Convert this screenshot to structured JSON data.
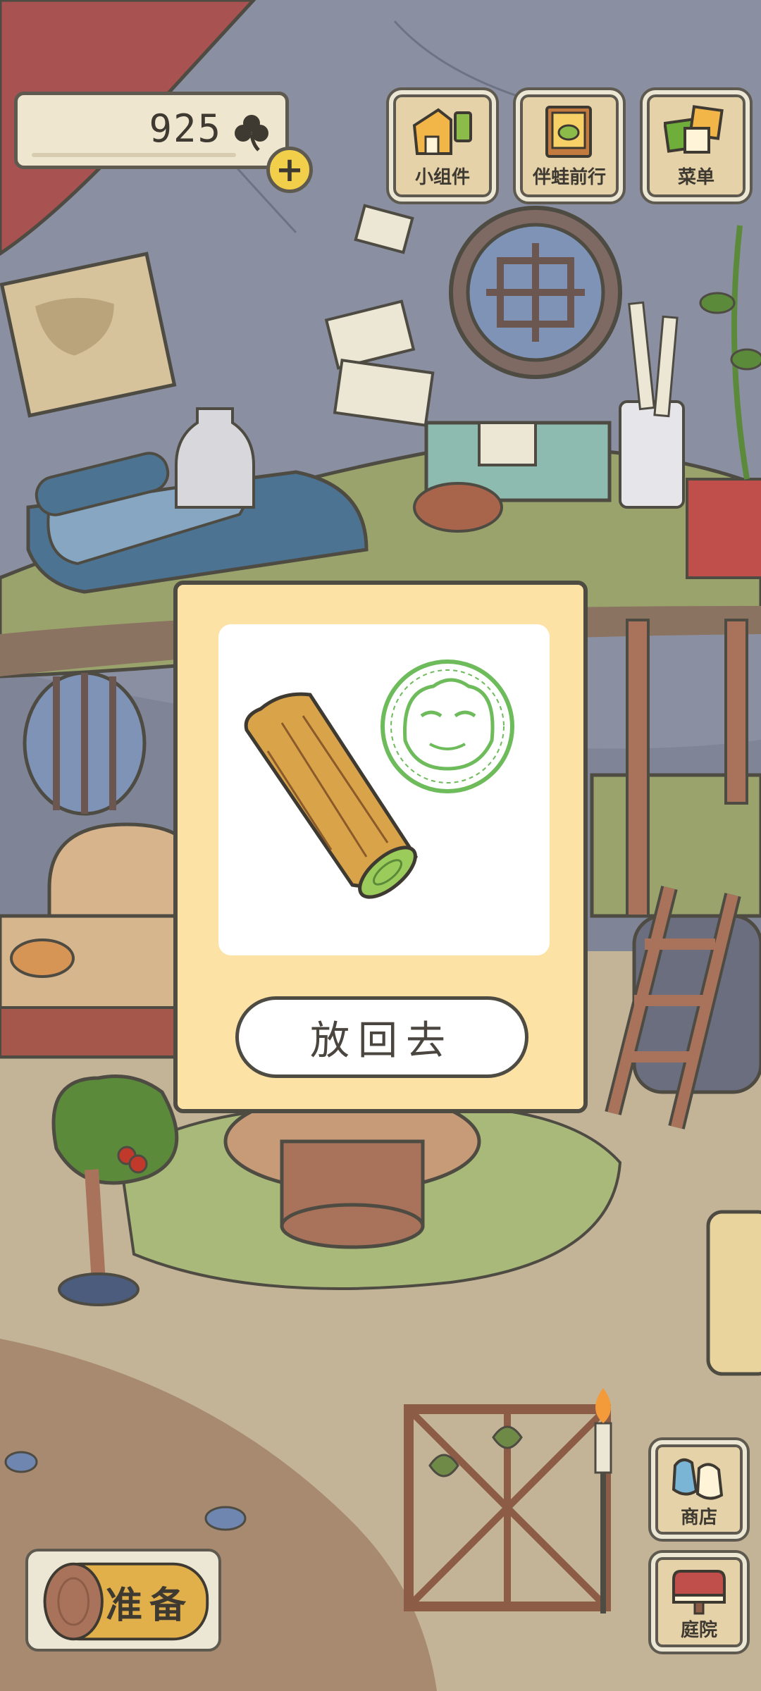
{
  "currency": {
    "amount": "925",
    "icon": "clover-icon",
    "add_icon": "plus-icon"
  },
  "top_buttons": [
    {
      "label": "小组件",
      "icon": "widget-icon"
    },
    {
      "label": "伴蛙前行",
      "icon": "frog-book-icon"
    },
    {
      "label": "菜单",
      "icon": "menu-cards-icon"
    }
  ],
  "side_buttons": [
    {
      "label": "商店",
      "icon": "shop-bags-icon"
    },
    {
      "label": "庭院",
      "icon": "yard-mailbox-icon"
    }
  ],
  "ready_button": {
    "label": "准备",
    "icon": "log-icon"
  },
  "item_dialog": {
    "item_icon": "log-item-icon",
    "stamp_icon": "frog-stamp-icon",
    "action_label": "放回去"
  },
  "colors": {
    "dialog_bg": "#fde2a6",
    "outline": "#4e4b43",
    "wood_button": "#e6d2a8",
    "plus_yellow": "#f2cf4a",
    "stamp_green": "#6dbb5a"
  }
}
